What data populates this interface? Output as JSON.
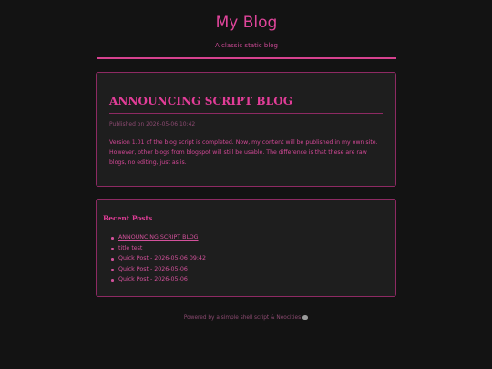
{
  "header": {
    "title": "My Blog",
    "tagline": "A classic static blog"
  },
  "post": {
    "title": "ANNOUNCING SCRIPT BLOG",
    "meta": "Published on 2026-05-06 10:42",
    "body": "Version 1.01 of the blog script is completed. Now, my content will be published in my own site. However, other blogs from blogspot will still be usable. The difference is that these are raw blogs, no editing, just as is."
  },
  "recent": {
    "title": "Recent Posts",
    "items": [
      {
        "label": "ANNOUNCING SCRIPT BLOG"
      },
      {
        "label": "title test"
      },
      {
        "label": "Quick Post - 2026-05-06 09:42"
      },
      {
        "label": "Quick Post - 2026-05-06"
      },
      {
        "label": "Quick Post - 2026-05-06"
      }
    ]
  },
  "footer": {
    "text": "Powered by a simple shell script & Neocities",
    "icon": "shell-icon"
  },
  "colors": {
    "background": "#131313",
    "card": "#1e1e1e",
    "accent": "#e23d98",
    "border": "#8e2a63"
  }
}
